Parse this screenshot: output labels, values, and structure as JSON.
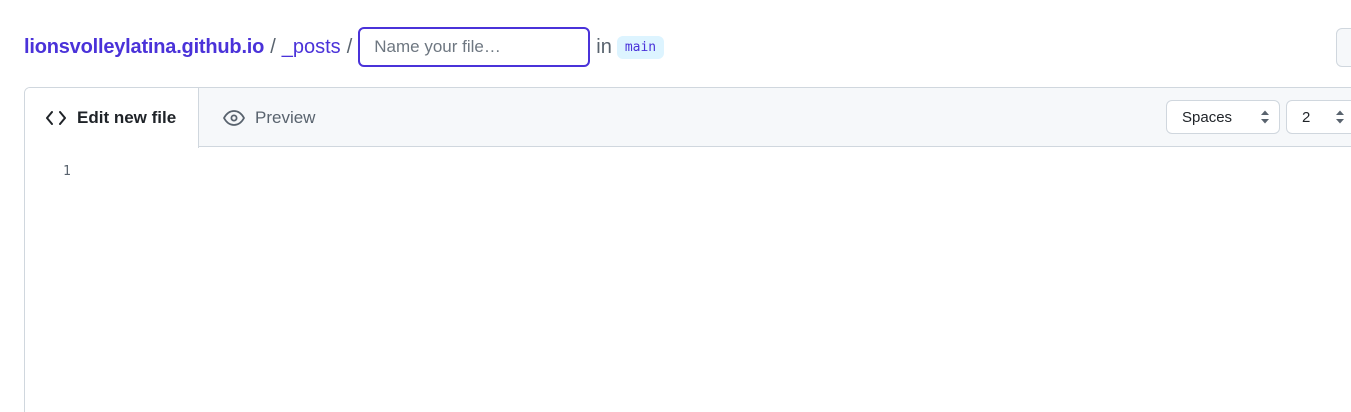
{
  "breadcrumb": {
    "repo": "lionsvolleylatina.github.io",
    "separator": "/",
    "directory": "_posts",
    "filename_placeholder": "Name your file…",
    "filename_value": "",
    "in_label": "in",
    "branch": "main"
  },
  "editor": {
    "tabs": [
      {
        "label": "Edit new file",
        "icon": "code-icon",
        "active": true
      },
      {
        "label": "Preview",
        "icon": "eye-icon",
        "active": false
      }
    ],
    "indent_mode": "Spaces",
    "indent_size": "2",
    "line_numbers": [
      "1"
    ],
    "content": ""
  },
  "colors": {
    "accent": "#4a32d9",
    "branch_badge_bg": "#ddf4ff",
    "border": "#d0d7de",
    "header_bg": "#f6f8fa",
    "muted_text": "#59636e"
  }
}
